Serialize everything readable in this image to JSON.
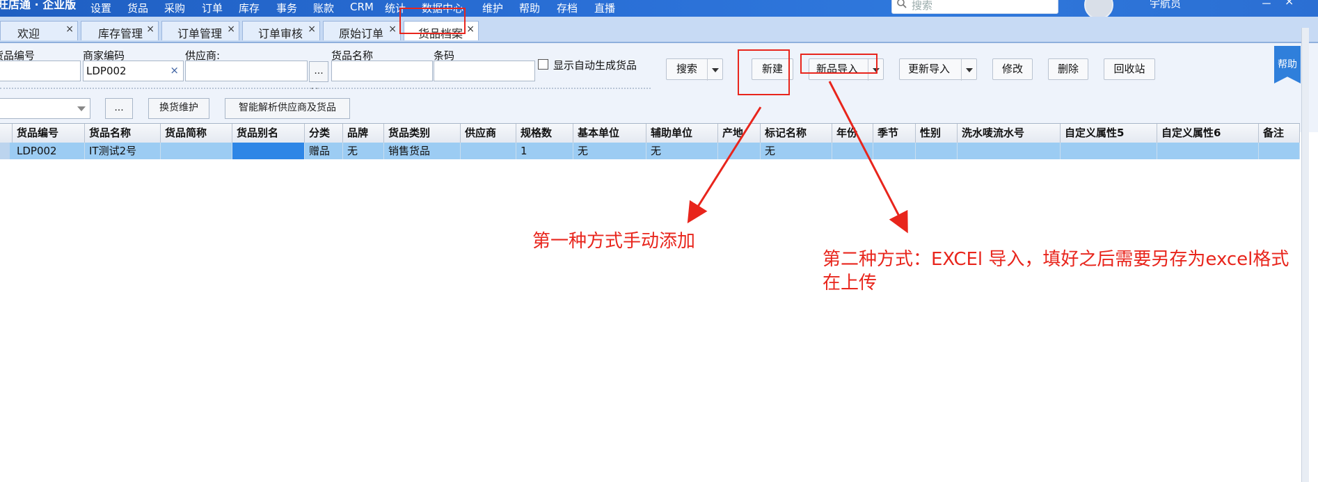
{
  "app": {
    "title": "旺店通 · 企业版"
  },
  "menu": [
    "设置",
    "货品",
    "采购",
    "订单",
    "库存",
    "事务",
    "账款",
    "CRM",
    "统计",
    "数据中心",
    "维护",
    "帮助",
    "存档",
    "直播"
  ],
  "top_search": {
    "placeholder": "搜索"
  },
  "top_user": {
    "name": "宇航员"
  },
  "window_controls": {
    "minimize": "－",
    "close": "×"
  },
  "tabs": [
    {
      "label": "欢迎",
      "active": false
    },
    {
      "label": "库存管理",
      "active": false
    },
    {
      "label": "订单管理",
      "active": false
    },
    {
      "label": "订单审核",
      "active": false
    },
    {
      "label": "原始订单",
      "active": false
    },
    {
      "label": "货品档案",
      "active": true
    }
  ],
  "tab_close": "×",
  "filters": {
    "goods_no_label": "货品编号",
    "merchant_code_label": "商家编码",
    "merchant_code_value": "LDP002",
    "supplier_label": "供应商:",
    "goods_name_label": "货品名称",
    "barcode_label": "条码",
    "show_auto_label": "显示自动生成货品",
    "ellipsis": "...",
    "more_dots": "...",
    "clear": "×"
  },
  "toolbar": {
    "search": "搜索",
    "new": "新建",
    "new_import": "新品导入",
    "update_import": "更新导入",
    "modify": "修改",
    "delete": "删除",
    "recycle": "回收站",
    "help": "帮助"
  },
  "second_row": {
    "ellipsis": "...",
    "replace_maint": "换货维护",
    "smart_parse": "智能解析供应商及货品"
  },
  "grid": {
    "columns": [
      "货品编号",
      "货品名称",
      "货品简称",
      "货品别名",
      "分类",
      "品牌",
      "货品类别",
      "供应商",
      "规格数",
      "基本单位",
      "辅助单位",
      "产地",
      "标记名称",
      "年份",
      "季节",
      "性别",
      "洗水唛流水号",
      "自定义属性5",
      "自定义属性6",
      "备注"
    ],
    "rows": [
      [
        "LDP002",
        "IT测试2号",
        "",
        "",
        "赠品",
        "无",
        "销售货品",
        "",
        "1",
        "无",
        "无",
        "",
        "无",
        "",
        "",
        "",
        "",
        "",
        "",
        ""
      ]
    ]
  },
  "annotations": {
    "first": "第一种方式手动添加",
    "second_line1": "第二种方式：EXCEl 导入，填好之后需要另存为excel格式",
    "second_line2": "在上传"
  },
  "colors": {
    "accent": "#2f7fdb",
    "annotation": "#e8251c",
    "selected_row": "#9cccf3"
  }
}
